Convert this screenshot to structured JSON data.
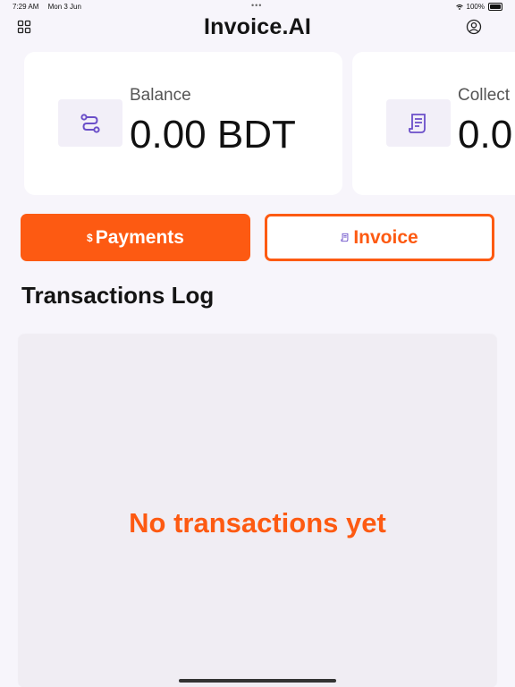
{
  "status_bar": {
    "time": "7:29 AM",
    "date": "Mon 3 Jun",
    "dots": "•••",
    "battery": "100%"
  },
  "header": {
    "title": "Invoice.AI",
    "menu_icon": "grid-icon",
    "profile_icon": "user-circle-icon"
  },
  "cards": [
    {
      "label": "Balance",
      "value": "0.00 BDT",
      "icon": "route-icon"
    },
    {
      "label": "Collect",
      "value": "0.0",
      "icon": "receipt-icon"
    }
  ],
  "buttons": {
    "payments_prefix": "$",
    "payments_label": "Payments",
    "invoice_label": "Invoice",
    "invoice_icon": "receipt-icon"
  },
  "transactions": {
    "title": "Transactions Log",
    "empty_message": "No transactions yet"
  },
  "colors": {
    "accent": "#fd5a12",
    "icon_purple": "#6b4fc9",
    "background": "#f7f5fb"
  }
}
